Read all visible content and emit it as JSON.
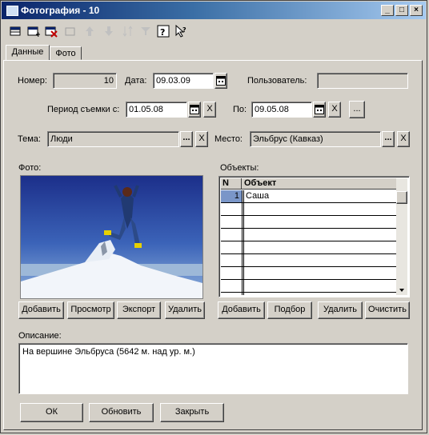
{
  "window": {
    "title": "Фотография - 10"
  },
  "tabs": [
    {
      "label": "Данные"
    },
    {
      "label": "Фото"
    }
  ],
  "fields": {
    "number_label": "Номер:",
    "number_value": "10",
    "date_label": "Дата:",
    "date_value": "09.03.09",
    "user_label": "Пользователь:",
    "user_value": "",
    "period_from_label": "Период съемки с:",
    "period_from_value": "01.05.08",
    "period_to_label": "По:",
    "period_to_value": "09.05.08",
    "topic_label": "Тема:",
    "topic_value": "Люди",
    "place_label": "Место:",
    "place_value": "Эльбрус (Кавказ)",
    "more_label": "...",
    "clear_label": "X"
  },
  "photo": {
    "label": "Фото:",
    "buttons": {
      "add": "Добавить",
      "view": "Просмотр",
      "export": "Экспорт",
      "delete": "Удалить"
    }
  },
  "objects": {
    "label": "Объекты:",
    "columns": {
      "n": "N",
      "object": "Объект"
    },
    "rows": [
      {
        "n": "1",
        "object": "Саша"
      }
    ],
    "buttons": {
      "add": "Добавить",
      "select": "Подбор",
      "delete": "Удалить",
      "clear": "Очистить"
    }
  },
  "description": {
    "label": "Описание:",
    "value": "На вершине Эльбруса (5642 м. над ур. м.)"
  },
  "footer": {
    "ok": "ОК",
    "refresh": "Обновить",
    "close": "Закрыть"
  },
  "colors": {
    "title_start": "#0a246a",
    "title_end": "#a6caf0",
    "face": "#d4d0c8",
    "selection": "#0a246a"
  }
}
